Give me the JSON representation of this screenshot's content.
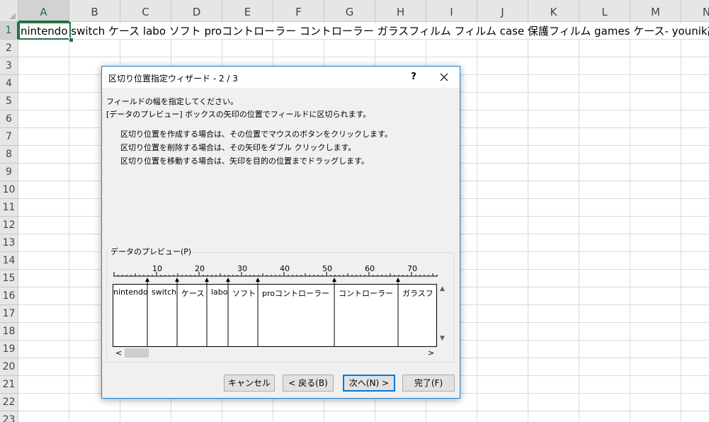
{
  "spreadsheet": {
    "columns": [
      "A",
      "B",
      "C",
      "D",
      "E",
      "F",
      "G",
      "H",
      "I",
      "J",
      "K",
      "L",
      "M",
      "N"
    ],
    "rows": [
      "1",
      "2",
      "3",
      "4",
      "5",
      "6",
      "7",
      "8",
      "9",
      "10",
      "11",
      "12",
      "13",
      "14",
      "15",
      "16",
      "17",
      "18",
      "19",
      "20",
      "21",
      "22",
      "23"
    ],
    "selected_column": "A",
    "selected_row": "1",
    "cell_a1": "nintendo switch ケース labo ソフト proコントローラー コントローラー ガラスフィルム フィルム case 保護フィルム games ケース- younik高品質"
  },
  "dialog": {
    "title": "区切り位置指定ウィザード - 2 / 3",
    "help_label": "?",
    "description": [
      "フィールドの幅を指定してください。",
      "[データのプレビュー] ボックスの矢印の位置でフィールドに区切られます。"
    ],
    "instructions": [
      "区切り位置を作成する場合は、その位置でマウスのボタンをクリックします。",
      "区切り位置を削除する場合は、その矢印をダブル クリックします。",
      "区切り位置を移動する場合は、矢印を目的の位置までドラッグします。"
    ],
    "preview_label": "データのプレビュー(P)",
    "ruler_labels": [
      "10",
      "20",
      "30",
      "40",
      "50",
      "60",
      "70"
    ],
    "preview_fields": [
      "nintendo",
      "switch",
      "ケース",
      "labo",
      "ソフト",
      "proコントローラー",
      "コントローラー",
      "ガラスフ"
    ],
    "buttons": {
      "cancel": "キャンセル",
      "back": "< 戻る(B)",
      "next": "次へ(N) >",
      "finish": "完了(F)"
    }
  },
  "colors": {
    "excel_green": "#217346",
    "dialog_border": "#1883d7",
    "default_button_border": "#0078d7"
  }
}
